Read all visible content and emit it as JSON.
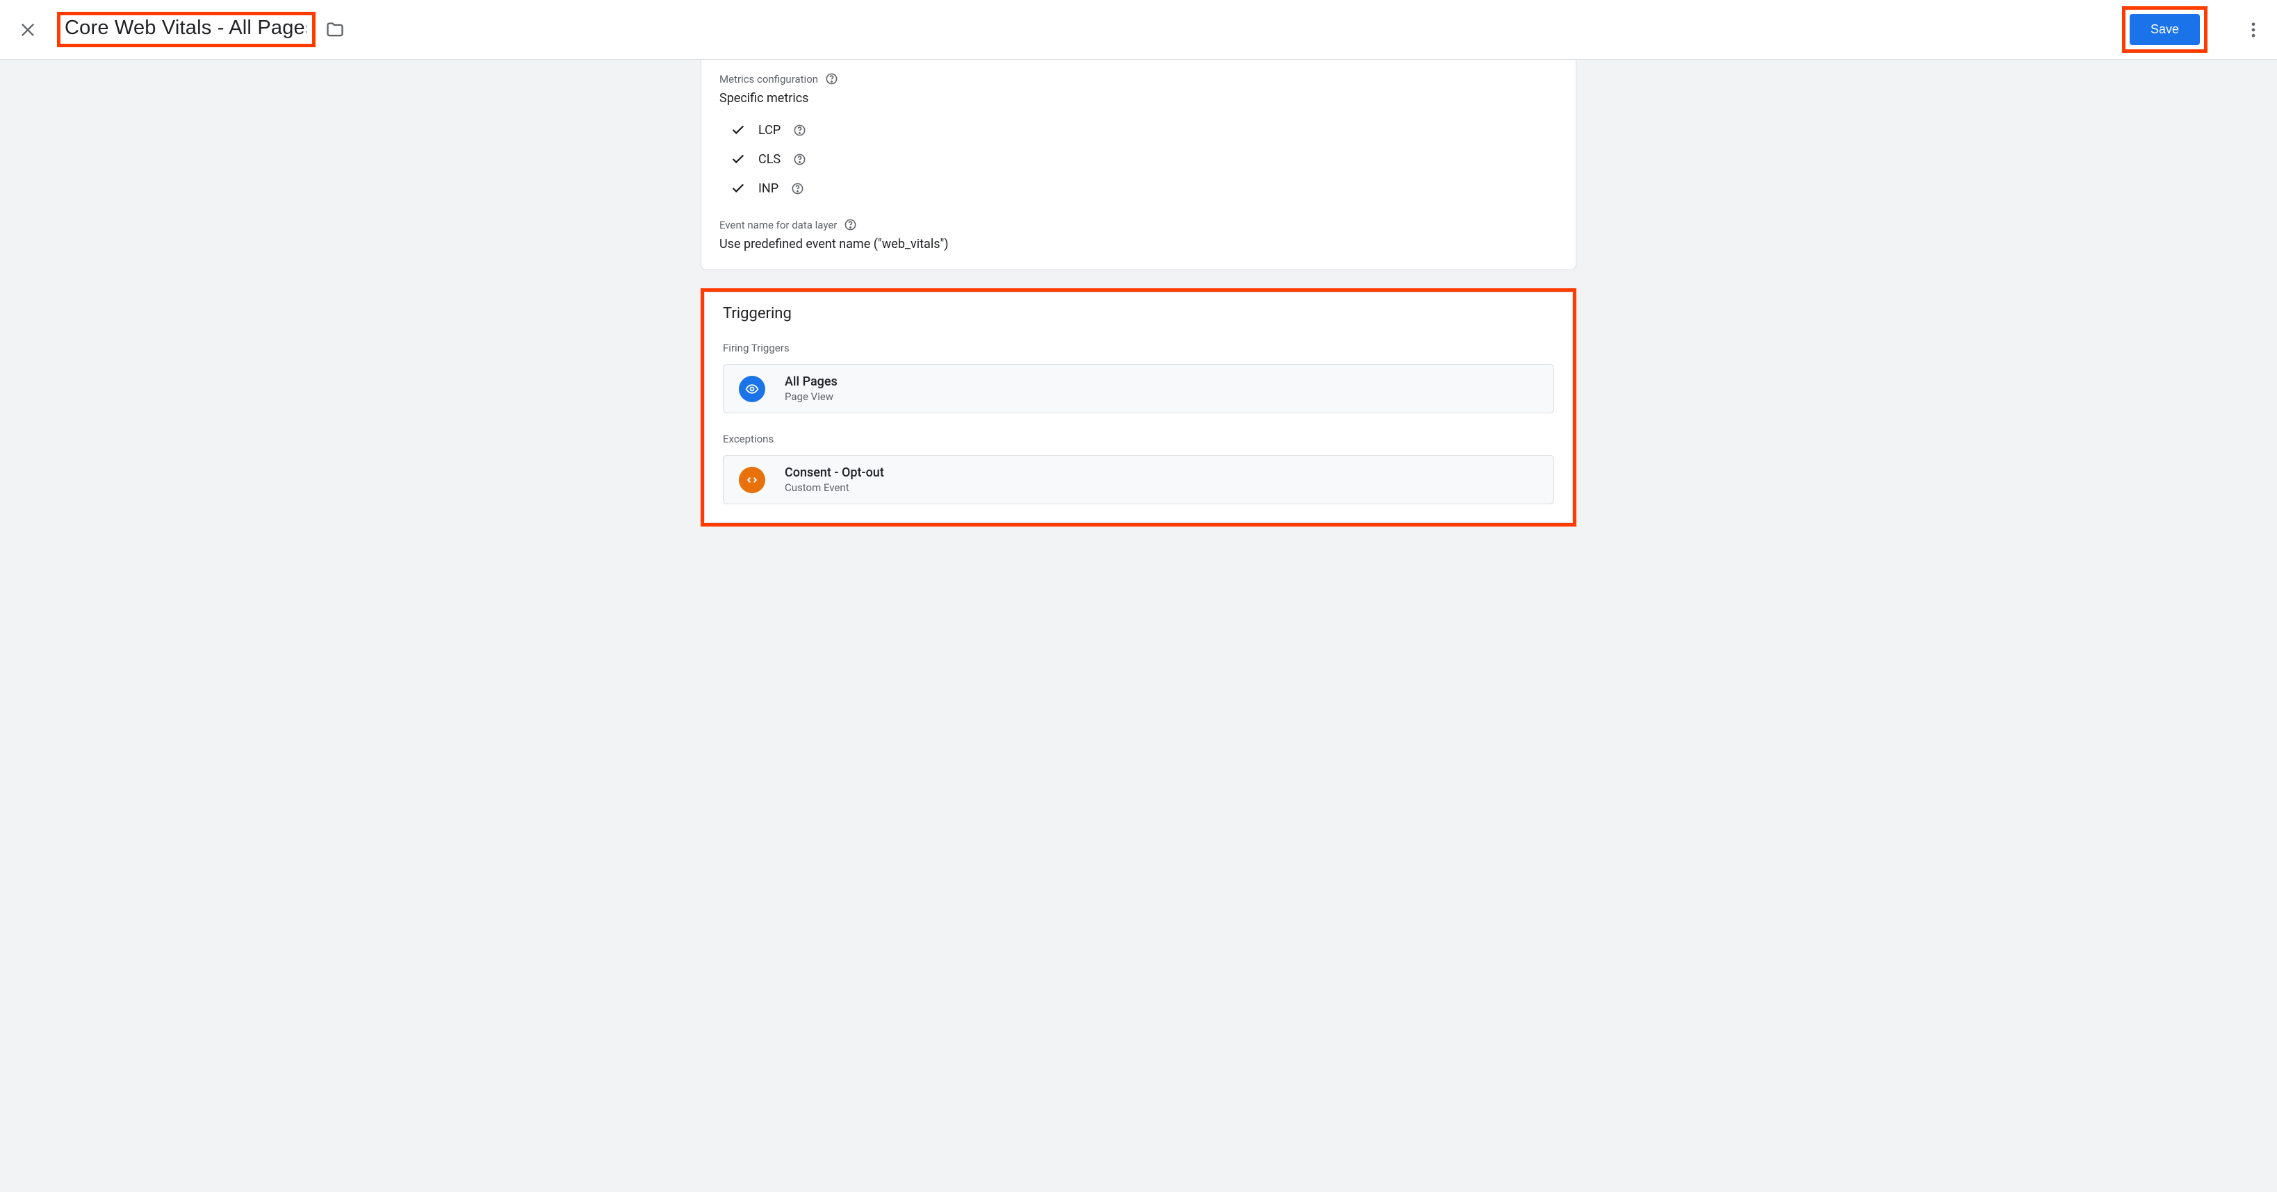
{
  "header": {
    "title": "Core Web Vitals - All Pages",
    "save_label": "Save"
  },
  "config": {
    "metrics_label": "Metrics configuration",
    "metrics_value": "Specific metrics",
    "metrics": [
      "LCP",
      "CLS",
      "INP"
    ],
    "event_name_label": "Event name for data layer",
    "event_name_value": "Use predefined event name (\"web_vitals\")"
  },
  "triggering": {
    "title": "Triggering",
    "firing_label": "Firing Triggers",
    "firing": [
      {
        "title": "All Pages",
        "sub": "Page View",
        "icon": "eye",
        "color": "blue"
      }
    ],
    "exceptions_label": "Exceptions",
    "exceptions": [
      {
        "title": "Consent - Opt-out",
        "sub": "Custom Event",
        "icon": "code",
        "color": "orange"
      }
    ]
  }
}
